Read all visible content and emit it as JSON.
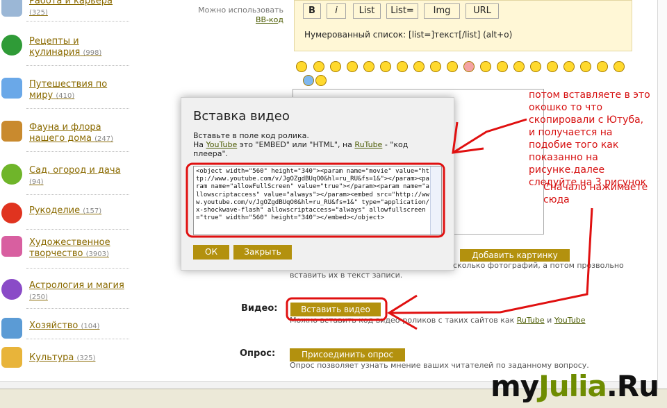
{
  "sidebar": {
    "items": [
      {
        "label": "Работа и карьера",
        "count": "(325)"
      },
      {
        "label": "Рецепты и кулинария",
        "count": "(998)"
      },
      {
        "label": "Путешествия по миру",
        "count": "(410)"
      },
      {
        "label": "Фауна и флора нашего дома",
        "count": "(247)"
      },
      {
        "label": "Сад, огород и дача",
        "count": "(94)"
      },
      {
        "label": "Рукоделие",
        "count": "(157)"
      },
      {
        "label": "Художественное творчество",
        "count": "(3903)"
      },
      {
        "label": "Астрология и магия",
        "count": "(250)"
      },
      {
        "label": "Хозяйство",
        "count": "(104)"
      },
      {
        "label": "Культура",
        "count": "(325)"
      }
    ]
  },
  "bbcode_hint": {
    "line1": "Можно использовать",
    "link": "BB-код"
  },
  "toolbar": {
    "buttons": [
      "B",
      "i",
      "List",
      "List=",
      "Img",
      "URL"
    ],
    "note": "Нумерованный список: [list=]текст[/list]  (alt+o)"
  },
  "modal": {
    "title": "Вставка видео",
    "desc_line1": "Вставьте в поле код ролика.",
    "desc_p1": "На ",
    "desc_youtube": "YouTube",
    "desc_p2": " это \"EMBED\" или \"HTML\", на ",
    "desc_rutube": "RuTube",
    "desc_p3": " - \"код плеера\".",
    "code": "<object width=\"560\" height=\"340\"><param name=\"movie\" value=\"http://www.youtube.com/v/JgOZgdBUqO0&hl=ru_RU&fs=1&\"></param><param name=\"allowFullScreen\" value=\"true\"></param><param name=\"allowscriptaccess\" value=\"always\"></param><embed src=\"http://www.youtube.com/v/JgOZgdBUqO0&hl=ru_RU&fs=1&\" type=\"application/x-shockwave-flash\" allowscriptaccess=\"always\" allowfullscreen=\"true\" width=\"560\" height=\"340\"></embed></object>",
    "ok_label": "ОК",
    "close_label": "Закрыть"
  },
  "photo": {
    "add_label": "Добавить картинку",
    "hint_tail": "сколько фотографий, а потом прозвольно",
    "hint_line2": "вставить их в текст записи."
  },
  "video": {
    "label": "Видео:",
    "button": "Вставить видео",
    "hint_prefix": "Можно вставить код видео-роликов с таких сайтов как ",
    "hint_rutube": "RuTube",
    "hint_and": " и ",
    "hint_youtube": "YouTube"
  },
  "poll": {
    "label": "Опрос:",
    "button": "Присоединить опрос",
    "hint": "Опрос позволяет узнать мнение ваших читателей по заданному вопросу."
  },
  "annotations": {
    "note1": "потом вставляете в это окошко то что скопировали с Ютуба, и получается на подобие того как показанно на рисунке.далее следуйте на 3 рисунок",
    "note2": "Сначало нажимаете сюда"
  },
  "watermark": {
    "part1": "my",
    "part2": "Julia",
    "part3": ".Ru"
  },
  "colors": {
    "accent": "#b3910e",
    "annotation": "#d61010",
    "link": "#8a6a00"
  }
}
